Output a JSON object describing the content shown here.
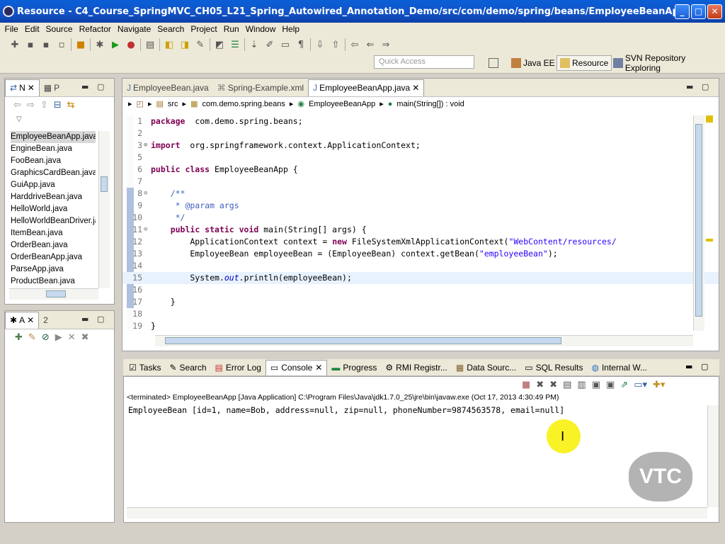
{
  "window": {
    "title": "Resource - C4_Course_SpringMVC_CH05_L21_Spring_Autowired_Annotation_Demo/src/com/demo/spring/beans/EmployeeBeanApp.java - Eclipse"
  },
  "menu": [
    "File",
    "Edit",
    "Source",
    "Refactor",
    "Navigate",
    "Search",
    "Project",
    "Run",
    "Window",
    "Help"
  ],
  "toolbar": {
    "quick_access_placeholder": "Quick Access",
    "perspectives": [
      "Java EE",
      "Resource",
      "SVN Repository Exploring"
    ]
  },
  "left_top_panel": {
    "tabs": [
      {
        "label": "N"
      },
      {
        "label": "P"
      }
    ],
    "files": [
      "EmployeeBeanApp.java",
      "EngineBean.java",
      "FooBean.java",
      "GraphicsCardBean.java",
      "GuiApp.java",
      "HarddriveBean.java",
      "HelloWorld.java",
      "HelloWorldBeanDriver.jav",
      "ItemBean.java",
      "OrderBean.java",
      "OrderBeanApp.java",
      "ParseApp.java",
      "ProductBean.java"
    ],
    "selected_file": "EmployeeBeanApp.java"
  },
  "left_bottom_panel": {
    "tabs": [
      {
        "label": "A"
      },
      {
        "label": "2"
      }
    ]
  },
  "editor": {
    "tabs": [
      "EmployeeBean.java",
      "Spring-Example.xml",
      "EmployeeBeanApp.java"
    ],
    "active_tab": "EmployeeBeanApp.java",
    "breadcrumb": [
      "src",
      "com.demo.spring.beans",
      "EmployeeBeanApp",
      "main(String[]) : void"
    ],
    "lines": [
      {
        "n": "1",
        "segs": [
          [
            "kw",
            "package"
          ],
          [
            "",
            "  com.demo.spring.beans;"
          ]
        ]
      },
      {
        "n": "2",
        "segs": []
      },
      {
        "n": "3",
        "segs": [
          [
            "kw",
            "import"
          ],
          [
            "",
            "  org.springframework.context.ApplicationContext;"
          ]
        ]
      },
      {
        "n": "5",
        "segs": []
      },
      {
        "n": "6",
        "segs": [
          [
            "kw",
            "public class"
          ],
          [
            "",
            " EmployeeBeanApp {"
          ]
        ]
      },
      {
        "n": "7",
        "segs": []
      },
      {
        "n": "8",
        "segs": [
          [
            "cm",
            "    /**"
          ]
        ]
      },
      {
        "n": "9",
        "segs": [
          [
            "cm",
            "     * @param args"
          ]
        ]
      },
      {
        "n": "10",
        "segs": [
          [
            "cm",
            "     */"
          ]
        ]
      },
      {
        "n": "11",
        "segs": [
          [
            "",
            "    "
          ],
          [
            "kw",
            "public static void"
          ],
          [
            "",
            " main(String[] args) {"
          ]
        ]
      },
      {
        "n": "12",
        "segs": [
          [
            "",
            "        ApplicationContext context = "
          ],
          [
            "kw",
            "new"
          ],
          [
            "",
            " FileSystemXmlApplicationContext("
          ],
          [
            "str",
            "\"WebContent/resources/"
          ]
        ]
      },
      {
        "n": "13",
        "segs": [
          [
            "",
            "        EmployeeBean employeeBean = (EmployeeBean) context.getBean("
          ],
          [
            "str",
            "\"employeeBean\""
          ],
          [
            "",
            ");"
          ]
        ]
      },
      {
        "n": "14",
        "segs": []
      },
      {
        "n": "15",
        "segs": [
          [
            "",
            "        System."
          ],
          [
            "it",
            "out"
          ],
          [
            "",
            ".println(employeeBean);"
          ]
        ]
      },
      {
        "n": "16",
        "segs": []
      },
      {
        "n": "17",
        "segs": [
          [
            "",
            "    }"
          ]
        ]
      },
      {
        "n": "18",
        "segs": []
      },
      {
        "n": "19",
        "segs": [
          [
            "",
            "}"
          ]
        ]
      }
    ]
  },
  "console": {
    "tabs": [
      "Tasks",
      "Search",
      "Error Log",
      "Console",
      "Progress",
      "RMI Registr...",
      "Data Sourc...",
      "SQL Results",
      "Internal W..."
    ],
    "active_tab": "Console",
    "status": "<terminated> EmployeeBeanApp [Java Application] C:\\Program Files\\Java\\jdk1.7.0_25\\jre\\bin\\javaw.exe (Oct 17, 2013 4:30:49 PM)",
    "output": "EmployeeBean [id=1, name=Bob, address=null, zip=null, phoneNumber=9874563578, email=null]"
  },
  "watermark": "VTC"
}
